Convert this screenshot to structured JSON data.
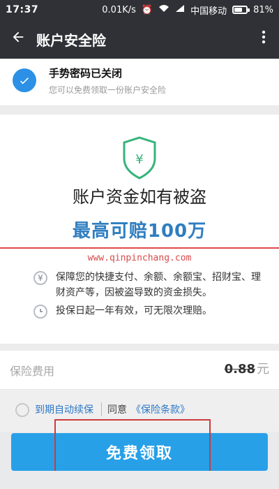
{
  "status_bar": {
    "time": "17:37",
    "speed": "0.01K/s",
    "carrier": "中国移动",
    "battery": "81%",
    "battery_level": 0.81,
    "icons": [
      "alarm-icon",
      "wifi-icon",
      "signal-icon",
      "battery-icon"
    ]
  },
  "app_bar": {
    "title": "账户安全险",
    "back_icon": "arrow-left-icon",
    "more_icon": "more-vert-icon"
  },
  "notice": {
    "title": "手势密码已关闭",
    "subtitle": "您可以免费领取一份账户安全险",
    "icon": "check-circle-icon"
  },
  "main": {
    "shield_icon": "yen-shield-icon",
    "headline": "账户资金如有被盗",
    "subheadline": "最高可赔100万",
    "watermark": "www.qinpinchang.com",
    "features": [
      {
        "icon": "yen-circle-icon",
        "text": "保障您的快捷支付、余额、余额宝、招财宝、理财资产等，因被盗导致的资金损失。"
      },
      {
        "icon": "clock-icon",
        "text": "投保日起一年有效，可无限次理赔。"
      }
    ]
  },
  "fee": {
    "label": "保险费用",
    "price": "0.88",
    "unit": "元"
  },
  "agreement": {
    "auto_renew": "到期自动续保",
    "agree_text": "同意",
    "terms": "《保险条款》"
  },
  "cta": {
    "label": "免费领取"
  },
  "colors": {
    "primary": "#28a0e8",
    "link": "#2b78c6",
    "highlight": "#cc3b3b",
    "appbar": "#2f3136",
    "shield": "#35b37a"
  }
}
